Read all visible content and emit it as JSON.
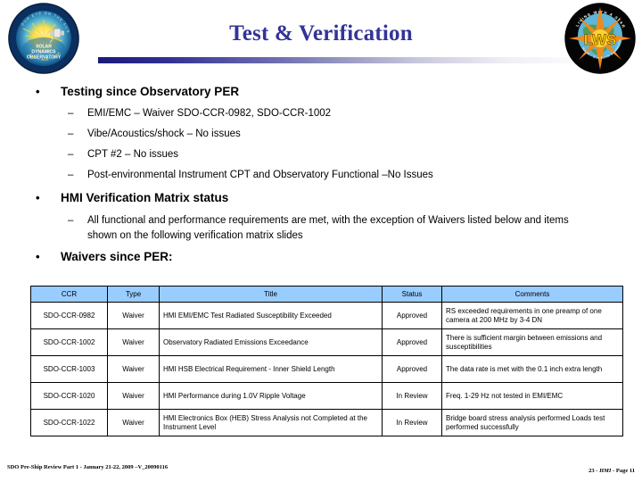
{
  "header": {
    "title": "Test & Verification",
    "left_logo": {
      "name": "sdo-logo",
      "arc_text": "OUR EYE ON THE SUN",
      "line1": "SOLAR",
      "line2": "DYNAMICS",
      "line3": "OBSERVATORY",
      "footer": "HMI  -  AIA  -  EVE"
    },
    "right_logo": {
      "name": "lws-logo",
      "arc_text": "LIVING WITH A STAR",
      "acronym": "LWS"
    }
  },
  "bullets": {
    "b1": {
      "label": "Testing since Observatory PER",
      "marker": "•",
      "sub_marker": "–",
      "subs": [
        "EMI/EMC – Waiver SDO-CCR-0982, SDO-CCR-1002",
        "Vibe/Acoustics/shock – No issues",
        "CPT #2 – No issues",
        "Post-environmental Instrument CPT and Observatory Functional –No Issues"
      ]
    },
    "b2": {
      "label": "HMI Verification Matrix status",
      "marker": "•",
      "sub_marker": "–",
      "subs": [
        "All functional and performance requirements are met, with the exception of  Waivers listed below and items shown on the following verification matrix slides"
      ]
    },
    "b3": {
      "label": "Waivers since PER:",
      "marker": "•"
    }
  },
  "table": {
    "headers": [
      "CCR",
      "Type",
      "Title",
      "Status",
      "Comments"
    ],
    "header_bg": "#99CCFF",
    "rows": [
      {
        "ccr": "SDO-CCR-0982",
        "type": "Waiver",
        "title": "HMI EMI/EMC Test Radiated Susceptibility Exceeded",
        "status": "Approved",
        "comments": "RS exceeded requirements in one preamp of one camera at 200 MHz  by 3-4 DN"
      },
      {
        "ccr": "SDO-CCR-1002",
        "type": "Waiver",
        "title": "Observatory Radiated Emissions Exceedance",
        "status": "Approved",
        "comments": "There is sufficient margin between emissions and susceptibilities"
      },
      {
        "ccr": "SDO-CCR-1003",
        "type": "Waiver",
        "title": "HMI HSB Electrical Requirement - Inner Shield Length",
        "status": "Approved",
        "comments": "The data rate is met with the 0.1 inch extra length"
      },
      {
        "ccr": "SDO-CCR-1020",
        "type": "Waiver",
        "title": "HMI Performance during 1.0V Ripple Voltage",
        "status": "In Review",
        "comments": "Freq. 1-29 Hz not tested in EMI/EMC"
      },
      {
        "ccr": "SDO-CCR-1022",
        "type": "Waiver",
        "title": "HMI Electronics Box (HEB) Stress Analysis not Completed at the Instrument Level",
        "status": "In Review",
        "comments": "Bridge board stress analysis performed Loads test performed successfully"
      }
    ]
  },
  "footer": {
    "left": "SDO Pre-Ship Review Part 1 - January 21-22, 2009 –V_20090116",
    "right_prefix": "23 - ",
    "right_em": "HMI",
    "right_suffix": " - Page 11"
  },
  "colors": {
    "title": "#333399",
    "rule_start": "#1a1a7a",
    "table_header": "#99CCFF"
  }
}
